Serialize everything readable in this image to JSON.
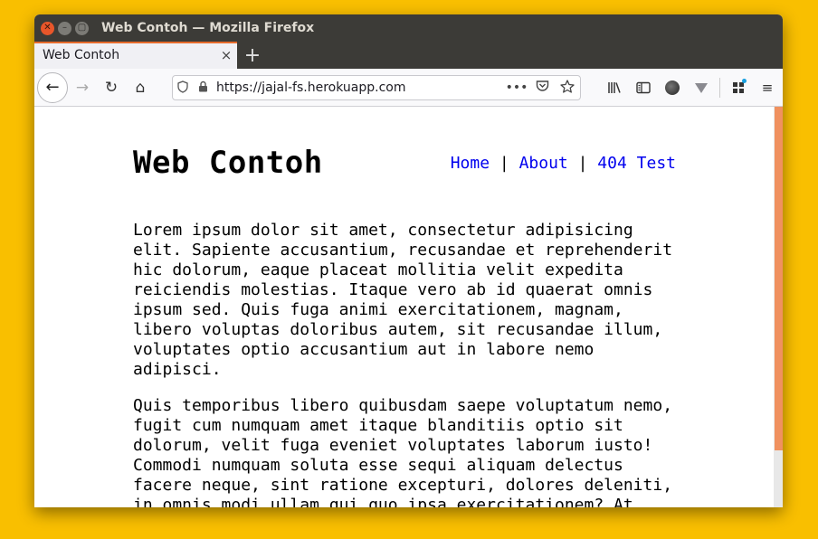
{
  "window": {
    "title": "Web Contoh — Mozilla Firefox"
  },
  "tabs": [
    {
      "label": "Web Contoh",
      "active": true
    }
  ],
  "urlbar": {
    "url": "https://jajal-fs.herokuapp.com"
  },
  "icons": {
    "back": "←",
    "forward": "→",
    "reload": "↻",
    "home": "⌂",
    "close": "×",
    "new_tab": "+",
    "more": "•••",
    "menu": "≡"
  },
  "site": {
    "title": "Web Contoh",
    "nav": [
      {
        "label": "Home"
      },
      {
        "label": "About"
      },
      {
        "label": "404 Test"
      }
    ],
    "nav_separator": "|",
    "paragraphs": [
      "Lorem ipsum dolor sit amet, consectetur adipisicing elit. Sapiente accusantium, recusandae et reprehenderit hic dolorum, eaque placeat mollitia velit expedita reiciendis molestias. Itaque vero ab id quaerat omnis ipsum sed. Quis fuga animi exercitationem, magnam, libero voluptas doloribus autem, sit recusandae illum, voluptates optio accusantium aut in labore nemo adipisci.",
      "Quis temporibus libero quibusdam saepe voluptatum nemo, fugit cum numquam amet itaque blanditiis optio sit dolorum, velit fuga eveniet voluptates laborum iusto! Commodi numquam soluta esse sequi aliquam delectus facere neque, sint ratione excepturi, dolores deleniti, in omnis modi ullam qui quo ipsa exercitationem? At"
    ]
  },
  "colors": {
    "desktop": "#F9BF00",
    "titlebar": "#3C3B37",
    "tab_accent": "#E66B2C",
    "link": "#0000EE",
    "scrollbar_thumb": "#F0915F"
  }
}
